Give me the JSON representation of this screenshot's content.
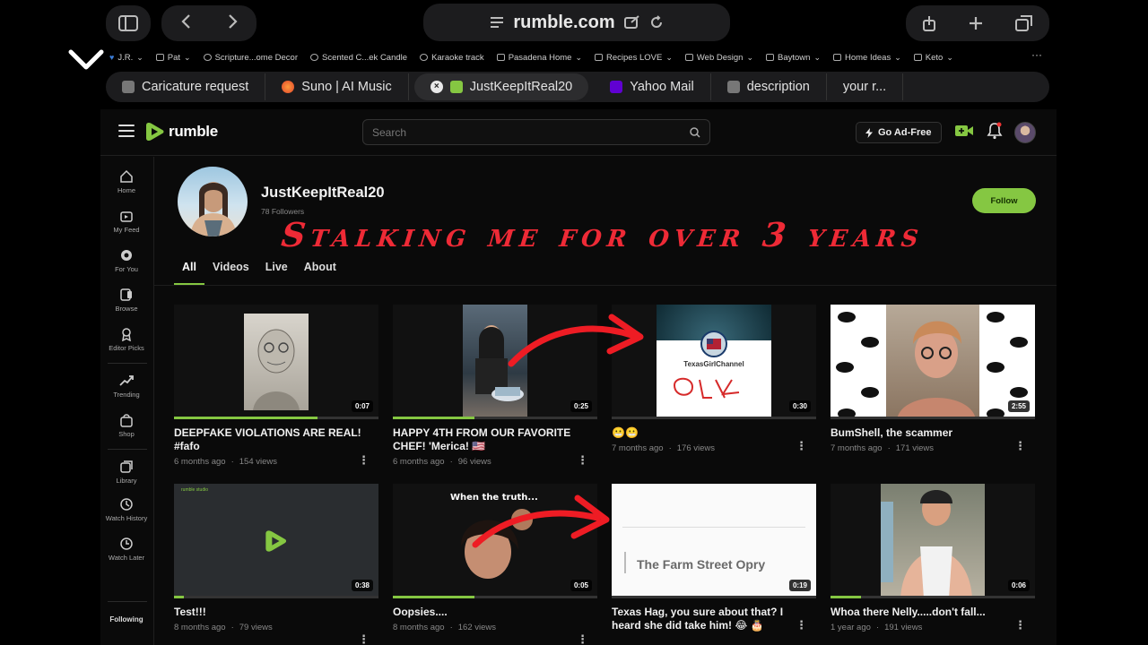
{
  "browser": {
    "url": "rumble.com",
    "bookmarks": [
      {
        "label": "J.R.",
        "icon": "heart-icon"
      },
      {
        "label": "Pat",
        "icon": "folder-icon"
      },
      {
        "label": "Scripture...ome Decor",
        "icon": "site-icon"
      },
      {
        "label": "Scented C...ek Candle",
        "icon": "site-icon"
      },
      {
        "label": "Karaoke track",
        "icon": "site-icon"
      },
      {
        "label": "Pasadena Home",
        "icon": "folder-icon"
      },
      {
        "label": "Recipes LOVE",
        "icon": "folder-icon"
      },
      {
        "label": "Web Design",
        "icon": "folder-icon"
      },
      {
        "label": "Baytown",
        "icon": "folder-icon"
      },
      {
        "label": "Home Ideas",
        "icon": "folder-icon"
      },
      {
        "label": "Keto",
        "icon": "folder-icon"
      }
    ],
    "more_glyph": "···",
    "tabs": [
      {
        "label": "Caricature request",
        "icon": "doc-icon"
      },
      {
        "label": "Suno | AI Music",
        "icon": "suno-icon"
      },
      {
        "label": "JustKeepItReal20",
        "icon": "rumble-icon",
        "active": true
      },
      {
        "label": "Yahoo Mail",
        "icon": "yahoo-icon"
      },
      {
        "label": "description",
        "icon": "doc-icon"
      },
      {
        "label": "your r...",
        "icon": ""
      }
    ]
  },
  "rumble": {
    "logo_text": "rumble",
    "search_placeholder": "Search",
    "go_adfree": "Go Ad-Free",
    "sidebar": [
      {
        "label": "Home",
        "icon": "home-icon"
      },
      {
        "label": "My Feed",
        "icon": "feed-icon"
      },
      {
        "label": "For You",
        "icon": "for-you-icon"
      },
      {
        "label": "Browse",
        "icon": "browse-icon"
      },
      {
        "label": "Editor Picks",
        "icon": "editor-picks-icon"
      },
      {
        "label": "Trending",
        "icon": "trending-icon"
      },
      {
        "label": "Shop",
        "icon": "shop-icon"
      },
      {
        "label": "Library",
        "icon": "library-icon"
      },
      {
        "label": "Watch History",
        "icon": "history-icon"
      },
      {
        "label": "Watch Later",
        "icon": "clock-icon"
      }
    ],
    "sidebar_following": "Following",
    "channel": {
      "name": "JustKeepItReal20",
      "followers": "78 Followers",
      "follow_label": "Follow"
    },
    "overlay_text": "Stalking  me for over 3 years",
    "profile_tabs": [
      "All",
      "Videos",
      "Live",
      "About"
    ],
    "videos": [
      {
        "title": "DEEPFAKE VIOLATIONS ARE REAL! #fafo",
        "age": "6 months ago",
        "views": "154 views",
        "duration": "0:07",
        "progress": 0.7
      },
      {
        "title": "HAPPY 4TH FROM OUR FAVORITE CHEF! 'Merica! 🇺🇸",
        "age": "6 months ago",
        "views": "96 views",
        "duration": "0:25",
        "progress": 0.4
      },
      {
        "title": "😬😬",
        "age": "7 months ago",
        "views": "176 views",
        "duration": "0:30",
        "progress": 0.0
      },
      {
        "title": "BumShell, the scammer",
        "age": "7 months ago",
        "views": "171 views",
        "duration": "2:55",
        "progress": 0.0
      },
      {
        "title": "Test!!!",
        "age": "8 months ago",
        "views": "79 views",
        "duration": "0:38",
        "progress": 0.05
      },
      {
        "title": "Oopsies....",
        "age": "8 months ago",
        "views": "162 views",
        "duration": "0:05",
        "progress": 0.4
      },
      {
        "title": "Texas Hag, you sure about that? I heard she did take him! 😂 🎂",
        "age": "",
        "views": "",
        "duration": "0:19",
        "progress": 0.0
      },
      {
        "title": "Whoa there Nelly.....don't fall...",
        "age": "1 year ago",
        "views": "191 views",
        "duration": "0:06",
        "progress": 0.15
      }
    ],
    "thumb_texts": {
      "studio_tag": "rumble studio",
      "texas_channel": "TexasGirlChannel",
      "when_truth": "When the truth...",
      "farm_street": "The Farm Street Opry"
    }
  },
  "colors": {
    "rumble_green": "#85c742",
    "overlay_red": "#ee2a36"
  }
}
